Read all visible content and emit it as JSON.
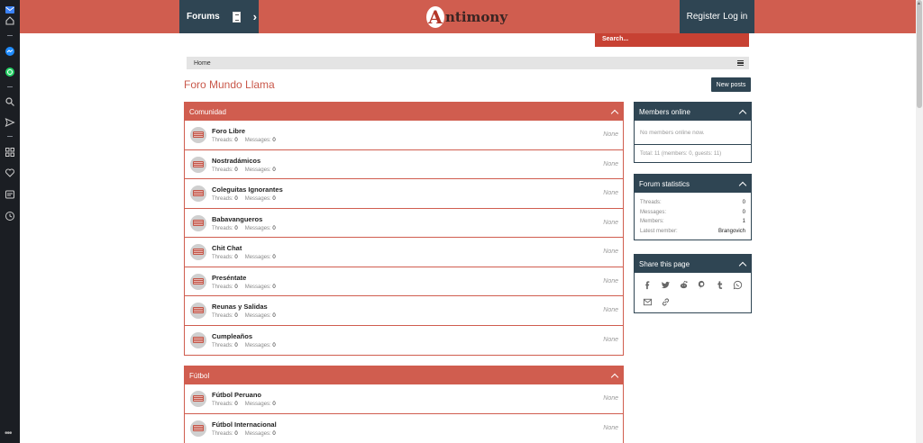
{
  "header": {
    "forums_label": "Forums",
    "logo_letter": "A",
    "logo_rest": "ntimony",
    "register_label": "Register",
    "login_label": "Log in"
  },
  "search": {
    "placeholder": "Search..."
  },
  "breadcrumb": {
    "home": "Home"
  },
  "page": {
    "title": "Foro Mundo Llama",
    "new_posts_label": "New posts"
  },
  "categories": [
    {
      "title": "Comunidad",
      "nodes": [
        {
          "title": "Foro Libre",
          "threads_label": "Threads:",
          "threads": "0",
          "messages_label": "Messages:",
          "messages": "0",
          "last": "None"
        },
        {
          "title": "Nostradámicos",
          "threads_label": "Threads:",
          "threads": "0",
          "messages_label": "Messages:",
          "messages": "0",
          "last": "None"
        },
        {
          "title": "Coleguitas Ignorantes",
          "threads_label": "Threads:",
          "threads": "0",
          "messages_label": "Messages:",
          "messages": "0",
          "last": "None"
        },
        {
          "title": "Babavangueros",
          "threads_label": "Threads:",
          "threads": "0",
          "messages_label": "Messages:",
          "messages": "0",
          "last": "None"
        },
        {
          "title": "Chit Chat",
          "threads_label": "Threads:",
          "threads": "0",
          "messages_label": "Messages:",
          "messages": "0",
          "last": "None"
        },
        {
          "title": "Preséntate",
          "threads_label": "Threads:",
          "threads": "0",
          "messages_label": "Messages:",
          "messages": "0",
          "last": "None"
        },
        {
          "title": "Reunas y Salidas",
          "threads_label": "Threads:",
          "threads": "0",
          "messages_label": "Messages:",
          "messages": "0",
          "last": "None"
        },
        {
          "title": "Cumpleaños",
          "threads_label": "Threads:",
          "threads": "0",
          "messages_label": "Messages:",
          "messages": "0",
          "last": "None"
        }
      ]
    },
    {
      "title": "Fútbol",
      "nodes": [
        {
          "title": "Fútbol Peruano",
          "threads_label": "Threads:",
          "threads": "0",
          "messages_label": "Messages:",
          "messages": "0",
          "last": "None"
        },
        {
          "title": "Fútbol Internacional",
          "threads_label": "Threads:",
          "threads": "0",
          "messages_label": "Messages:",
          "messages": "0",
          "last": "None"
        }
      ]
    }
  ],
  "members_online": {
    "title": "Members online",
    "empty": "No members online now.",
    "total": "Total: 11 (members: 0, guests: 11)"
  },
  "forum_statistics": {
    "title": "Forum statistics",
    "rows": [
      {
        "label": "Threads:",
        "value": "0"
      },
      {
        "label": "Messages:",
        "value": "0"
      },
      {
        "label": "Members:",
        "value": "1"
      },
      {
        "label": "Latest member:",
        "value": "Brangovich"
      }
    ]
  },
  "share": {
    "title": "Share this page",
    "icons": [
      "facebook-icon",
      "twitter-icon",
      "reddit-icon",
      "pinterest-icon",
      "tumblr-icon",
      "whatsapp-icon",
      "email-icon",
      "link-icon"
    ]
  },
  "colors": {
    "brand_red": "#d05d4f",
    "dark_slate": "#2f4553",
    "title_red": "#c9584a",
    "search_red": "#c74133"
  }
}
